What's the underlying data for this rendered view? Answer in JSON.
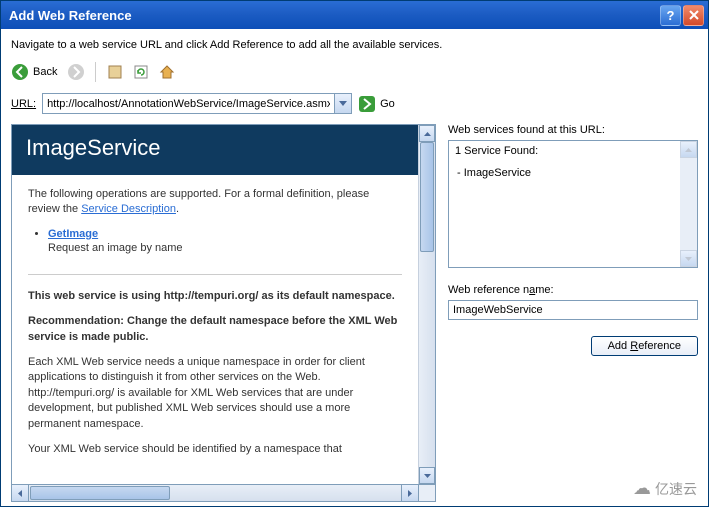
{
  "titlebar": {
    "title": "Add Web Reference"
  },
  "instruction": "Navigate to a web service URL and click Add Reference to add all the available services.",
  "toolbar": {
    "back_label": "Back"
  },
  "url": {
    "label": "URL:",
    "value": "http://localhost/AnnotationWebService/ImageService.asmx",
    "go_label": "Go"
  },
  "service_page": {
    "header": "ImageService",
    "intro_pre": "The following operations are supported. For a formal definition, please review the ",
    "service_desc_link": "Service Description",
    "operations": [
      {
        "name": "GetImage",
        "desc": "Request an image by name"
      }
    ],
    "ns_warning": "This web service is using http://tempuri.org/ as its default namespace.",
    "recommendation": "Recommendation: Change the default namespace before the XML Web service is made public.",
    "ns_detail": "Each XML Web service needs a unique namespace in order for client applications to distinguish it from other services on the Web. http://tempuri.org/ is available for XML Web services that are under development, but published XML Web services should use a more permanent namespace.",
    "ns_detail2": "Your XML Web service should be identified by a namespace that"
  },
  "right": {
    "found_label": "Web services found at this URL:",
    "count_text": "1 Service Found:",
    "items": [
      "- ImageService"
    ],
    "name_label": "Web reference name:",
    "name_value": "ImageWebService",
    "add_label": "Add Reference"
  },
  "watermark": "亿速云"
}
